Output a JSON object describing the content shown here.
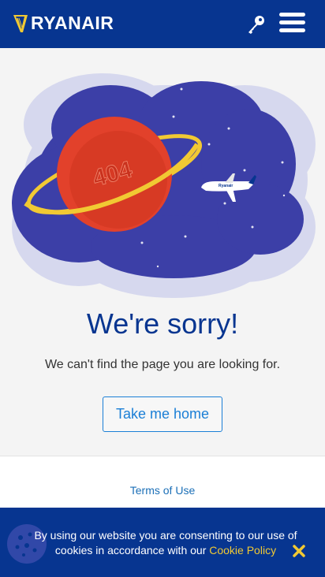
{
  "header": {
    "brand": "RYANAIR",
    "logo_icon": "harp-icon",
    "key_icon": "key-icon",
    "menu_icon": "hamburger-menu-icon"
  },
  "illustration": {
    "planet_label": "404",
    "plane_livery": "Ryanair"
  },
  "main": {
    "title": "We're sorry!",
    "message": "We can't find the page you are looking for.",
    "home_button": "Take me home"
  },
  "footer": {
    "terms_link": "Terms of Use"
  },
  "cookie_bar": {
    "text_before": "By using our website you are consenting to our use of cookies in accordance with our ",
    "policy_link": "Cookie Policy",
    "close_icon": "close-x-icon",
    "cookie_icon": "cookie-icon"
  },
  "colors": {
    "brand_blue": "#073590",
    "brand_yellow": "#f1c933",
    "link_blue": "#1b7fd6",
    "planet_red": "#e2412b",
    "space_purple": "#3c3fa7"
  }
}
